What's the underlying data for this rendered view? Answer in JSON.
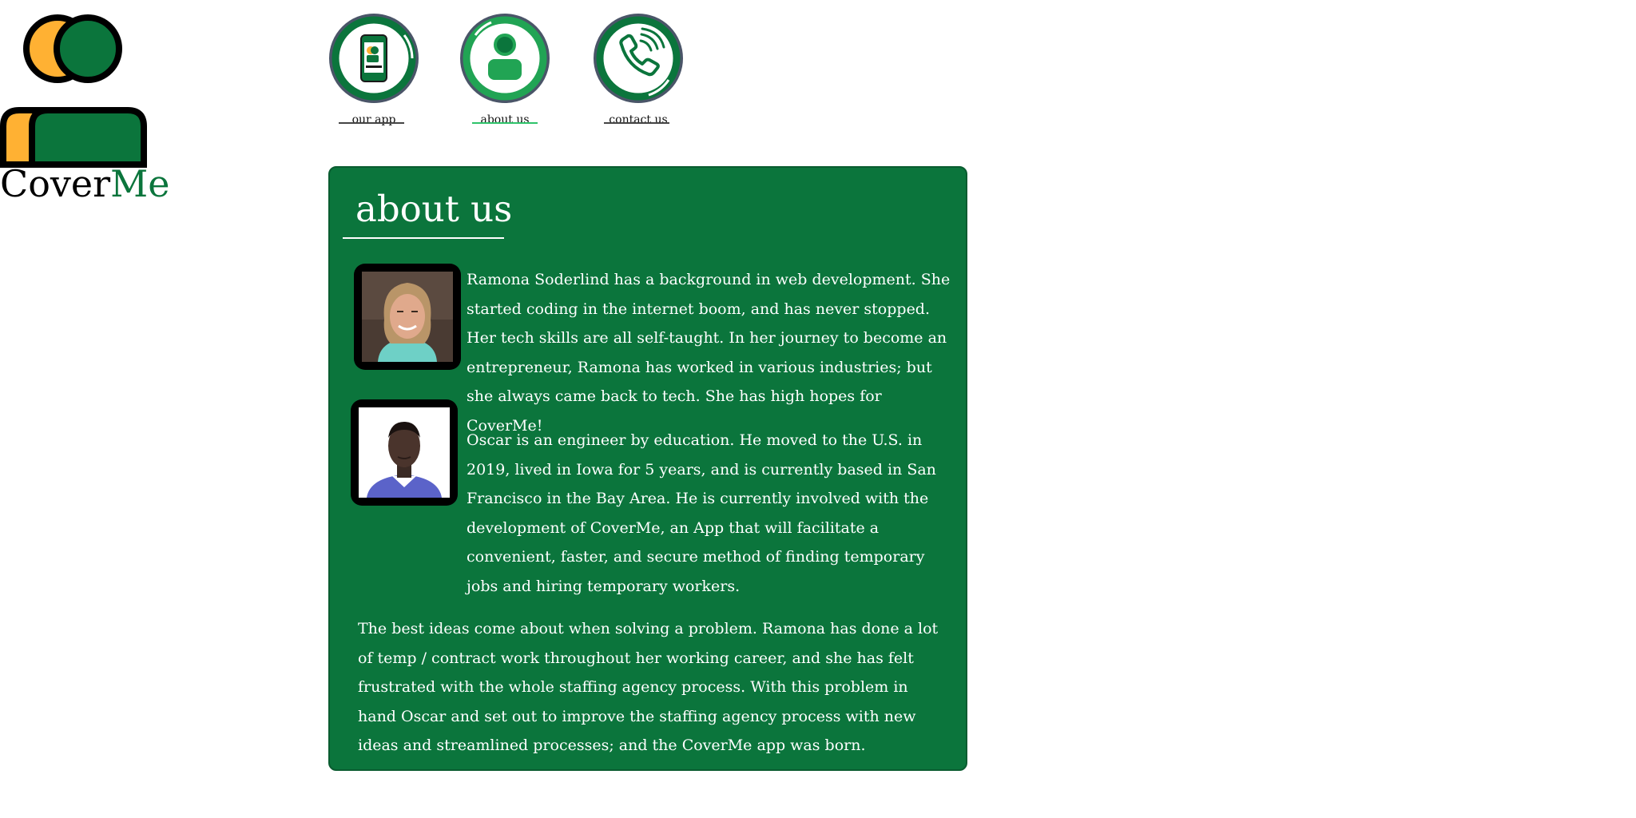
{
  "brand": {
    "name_part1": "Cover",
    "name_part2": "Me",
    "colors": {
      "green": "#0b753c",
      "orange": "#ffb133",
      "ring": "#4a5568"
    }
  },
  "nav": [
    {
      "label": "our app",
      "icon": "phone-app-icon",
      "active": false
    },
    {
      "label": "about us",
      "icon": "person-icon",
      "active": true
    },
    {
      "label": "contact us",
      "icon": "phone-call-icon",
      "active": false
    }
  ],
  "about": {
    "title": "about us",
    "bios": [
      {
        "name": "Ramona Soderlind",
        "text": "Ramona Soderlind has a background in web development. She started coding in the internet boom, and has never stopped. Her tech skills are all self-taught. In her journey to become an entrepreneur, Ramona has worked in various industries; but she always came back to tech. She has high hopes for CoverMe!"
      },
      {
        "name": "Oscar",
        "text": "Oscar is an engineer by education.  He moved to the U.S. in 2019, lived in Iowa for 5 years, and is currently based in San Francisco in the Bay Area. He is currently involved with the development of CoverMe, an App that will facilitate a convenient, faster, and secure  method of finding temporary jobs and hiring temporary workers."
      }
    ],
    "story": "The best ideas come about when solving a problem. Ramona has done a lot of temp / contract work throughout her working career, and she has felt frustrated with the whole staffing agency process. With this problem in hand Oscar and set out to improve the staffing agency process with new ideas and streamlined processes; and the CoverMe app was born."
  }
}
